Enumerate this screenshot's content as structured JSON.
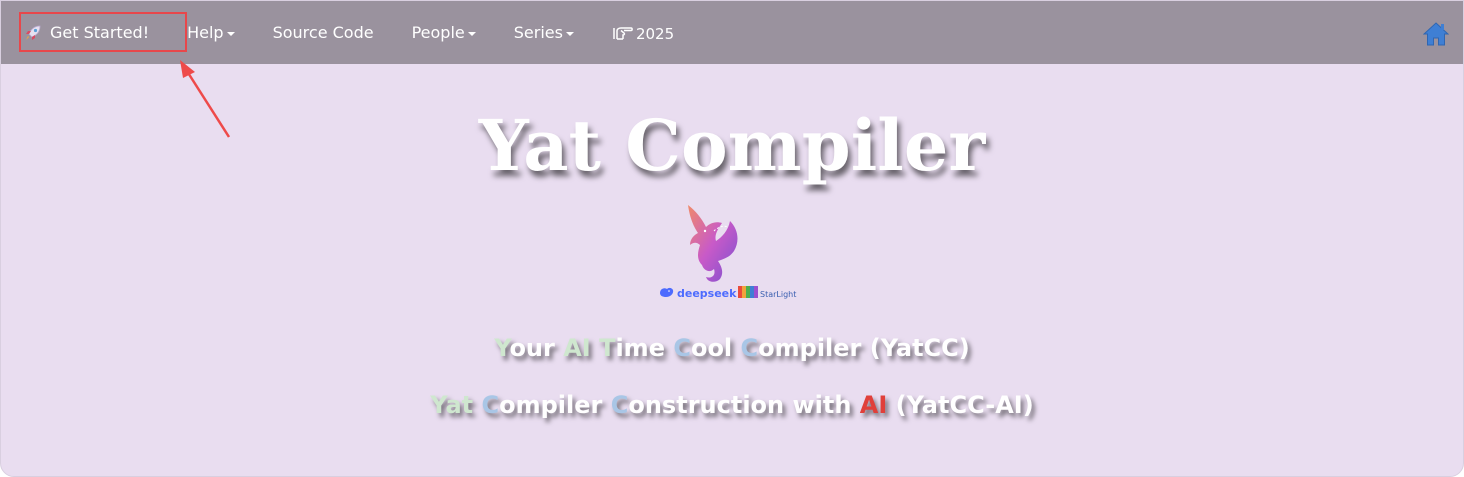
{
  "nav": {
    "get_started": "Get Started!",
    "help": "Help",
    "source_code": "Source Code",
    "people": "People",
    "series": "Series",
    "year": "2025",
    "icons": [
      "rocket-icon",
      "pointing-hand-icon",
      "home-icon"
    ]
  },
  "hero": {
    "title": "Yat Compiler",
    "logo_text": {
      "brand": "deepseek",
      "partner": "StarLight"
    },
    "tagline1": {
      "parts": [
        "Y",
        "our ",
        "AI",
        " ",
        "T",
        "ime ",
        "C",
        "ool ",
        "C",
        "ompiler (YatCC)"
      ]
    },
    "tagline2": {
      "parts": [
        "Yat",
        " ",
        "C",
        "ompiler ",
        "C",
        "onstruction with ",
        "AI",
        " (YatCC-AI)"
      ]
    }
  },
  "colors": {
    "navbar": "#9a929e",
    "background": "#e9ddf0",
    "highlight": "#e8474b",
    "accent_green": "#cfe7cf",
    "accent_blue": "#a9c6e6",
    "accent_red": "#e0403a"
  }
}
